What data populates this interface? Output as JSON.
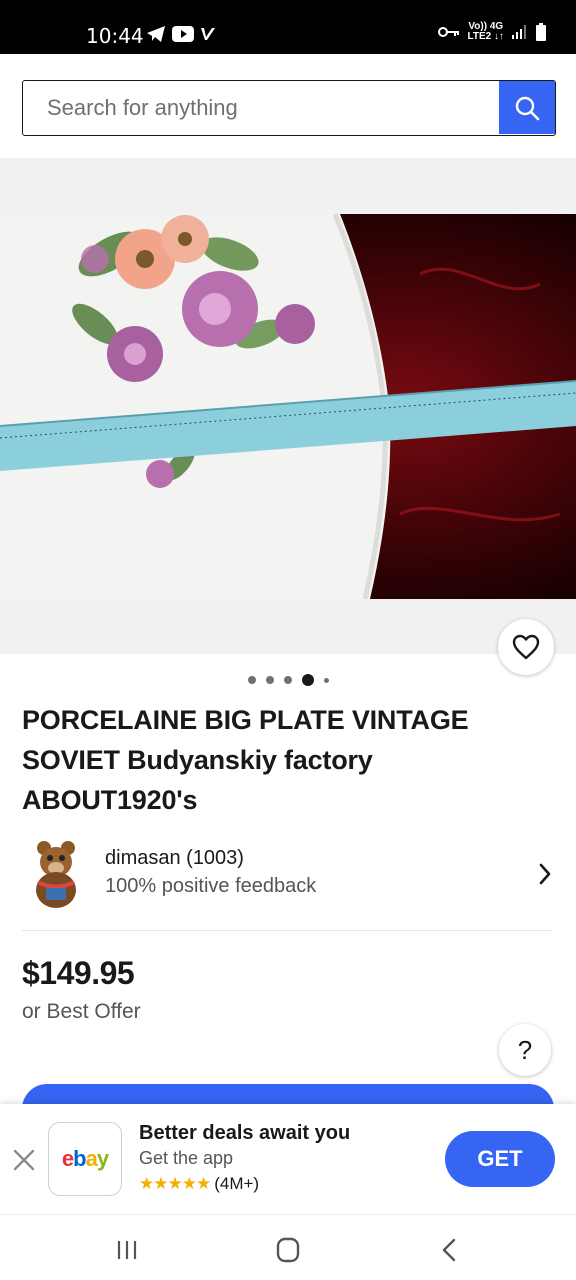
{
  "status_bar": {
    "time": "10:44",
    "network_top": "Vo)) 4G",
    "network_bottom": "LTE2 ↓↑"
  },
  "search": {
    "placeholder": "Search for anything"
  },
  "carousel": {
    "count": 5,
    "active_index": 3
  },
  "listing": {
    "title": "PORCELAINE BIG PLATE VINTAGE SOVIET Budyanskiy factory ABOUT1920's",
    "price": "$149.95",
    "offer_text": "or Best Offer"
  },
  "seller": {
    "name": "dimasan (1003)",
    "feedback": "100% positive feedback"
  },
  "help": {
    "label": "?"
  },
  "app_banner": {
    "logo_letters": [
      "e",
      "b",
      "a",
      "y"
    ],
    "title": "Better deals await you",
    "subtitle": "Get the app",
    "stars": "★★★★★",
    "rating_count": "(4M+)",
    "get_label": "GET"
  },
  "colors": {
    "accent": "#3665f3",
    "text": "#191919",
    "secondary_text": "#555555",
    "star": "#f5af02",
    "logo": [
      "#e53238",
      "#0064d2",
      "#f5af02",
      "#86b817"
    ]
  }
}
